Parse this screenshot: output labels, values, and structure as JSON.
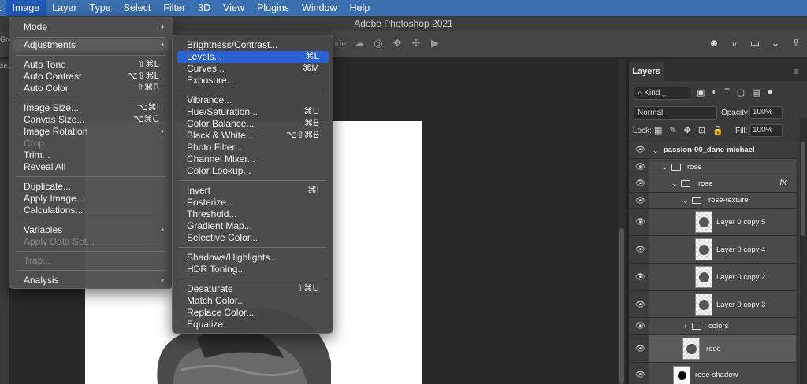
{
  "menubar": {
    "items": [
      "t",
      "Image",
      "Layer",
      "Type",
      "Select",
      "Filter",
      "3D",
      "View",
      "Plugins",
      "Window",
      "Help"
    ]
  },
  "title": "Adobe Photoshop 2021",
  "options_bar": {
    "mode_label": "ode:"
  },
  "tab_fragments": {
    "a": "Gro",
    "b": "se,"
  },
  "image_menu": {
    "mode": "Mode",
    "adjustments": "Adjustments",
    "auto_tone": "Auto Tone",
    "auto_tone_sc": "⇧⌘L",
    "auto_contrast": "Auto Contrast",
    "auto_contrast_sc": "⌥⇧⌘L",
    "auto_color": "Auto Color",
    "auto_color_sc": "⇧⌘B",
    "image_size": "Image Size...",
    "image_size_sc": "⌥⌘I",
    "canvas_size": "Canvas Size...",
    "canvas_size_sc": "⌥⌘C",
    "image_rotation": "Image Rotation",
    "crop": "Crop",
    "trim": "Trim...",
    "reveal_all": "Reveal All",
    "duplicate": "Duplicate...",
    "apply_image": "Apply Image...",
    "calculations": "Calculations...",
    "variables": "Variables",
    "apply_data_set": "Apply Data Set...",
    "trap": "Trap...",
    "analysis": "Analysis"
  },
  "adjust_menu": {
    "brightness": "Brightness/Contrast...",
    "levels": "Levels...",
    "levels_sc": "⌘L",
    "curves": "Curves...",
    "curves_sc": "⌘M",
    "exposure": "Exposure...",
    "vibrance": "Vibrance...",
    "hue_sat": "Hue/Saturation...",
    "hue_sat_sc": "⌘U",
    "color_balance": "Color Balance...",
    "color_balance_sc": "⌘B",
    "black_white": "Black & White...",
    "black_white_sc": "⌥⇧⌘B",
    "photo_filter": "Photo Filter...",
    "channel_mixer": "Channel Mixer...",
    "color_lookup": "Color Lookup...",
    "invert": "Invert",
    "invert_sc": "⌘I",
    "posterize": "Posterize...",
    "threshold": "Threshold...",
    "gradient_map": "Gradient Map...",
    "selective_color": "Selective Color...",
    "shadows_highlights": "Shadows/Highlights...",
    "hdr_toning": "HDR Toning...",
    "desaturate": "Desaturate",
    "desaturate_sc": "⇧⌘U",
    "match_color": "Match Color...",
    "replace_color": "Replace Color...",
    "equalize": "Equalize"
  },
  "layers_panel": {
    "tab": "Layers",
    "kind": "Kind",
    "blend_mode": "Normal",
    "opacity_label": "Opacity:",
    "opacity": "100%",
    "lock_label": "Lock:",
    "fill_label": "Fill:",
    "fill": "100%",
    "layers": [
      "passion-00_dane-michael",
      "rose",
      "rose",
      "rose-texture",
      "Layer 0 copy 5",
      "Layer 0 copy 4",
      "Layer 0 copy 2",
      "Layer 0 copy 3",
      "colors",
      "rose",
      "rose-shadow"
    ],
    "fx": "fx"
  }
}
